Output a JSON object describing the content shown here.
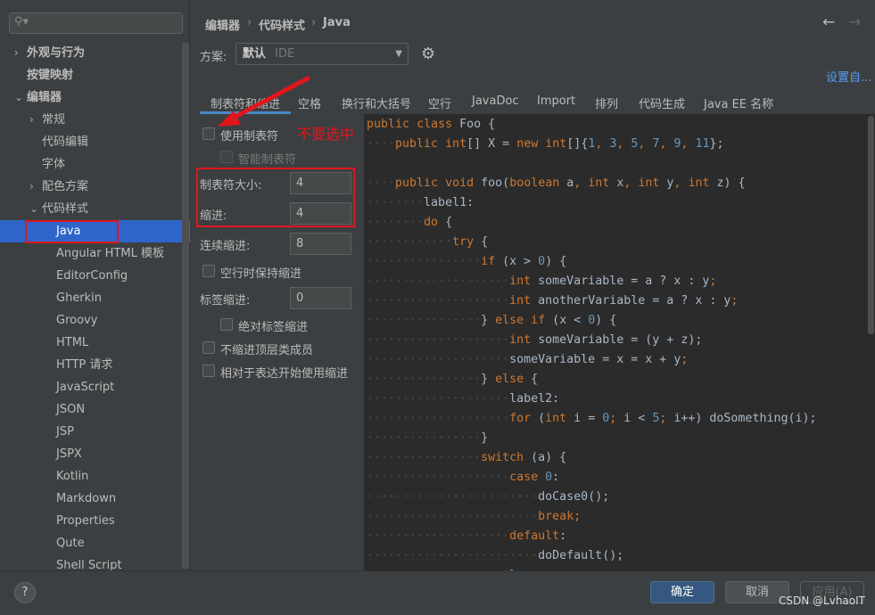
{
  "search": {
    "placeholder": ""
  },
  "sidebar": {
    "items": [
      {
        "label": "外观与行为",
        "arrow": "›",
        "level": 0
      },
      {
        "label": "按键映射",
        "arrow": "",
        "level": 0
      },
      {
        "label": "编辑器",
        "arrow": "⌄",
        "level": 0
      },
      {
        "label": "常规",
        "arrow": "›",
        "level": 1
      },
      {
        "label": "代码编辑",
        "arrow": "",
        "level": 1
      },
      {
        "label": "字体",
        "arrow": "",
        "level": 1
      },
      {
        "label": "配色方案",
        "arrow": "›",
        "level": 1
      },
      {
        "label": "代码样式",
        "arrow": "⌄",
        "level": 1
      },
      {
        "label": "Java",
        "arrow": "",
        "level": 2,
        "selected": true
      },
      {
        "label": "Angular HTML 模板",
        "arrow": "",
        "level": 2
      },
      {
        "label": "EditorConfig",
        "arrow": "",
        "level": 2
      },
      {
        "label": "Gherkin",
        "arrow": "",
        "level": 2
      },
      {
        "label": "Groovy",
        "arrow": "",
        "level": 2
      },
      {
        "label": "HTML",
        "arrow": "",
        "level": 2
      },
      {
        "label": "HTTP 请求",
        "arrow": "",
        "level": 2
      },
      {
        "label": "JavaScript",
        "arrow": "",
        "level": 2
      },
      {
        "label": "JSON",
        "arrow": "",
        "level": 2
      },
      {
        "label": "JSP",
        "arrow": "",
        "level": 2
      },
      {
        "label": "JSPX",
        "arrow": "",
        "level": 2
      },
      {
        "label": "Kotlin",
        "arrow": "",
        "level": 2
      },
      {
        "label": "Markdown",
        "arrow": "",
        "level": 2
      },
      {
        "label": "Properties",
        "arrow": "",
        "level": 2
      },
      {
        "label": "Qute",
        "arrow": "",
        "level": 2
      },
      {
        "label": "Shell Script",
        "arrow": "",
        "level": 2
      }
    ]
  },
  "breadcrumb": [
    "编辑器",
    "代码样式",
    "Java"
  ],
  "nav": {
    "back": "←",
    "forward": "→"
  },
  "scheme": {
    "label": "方案:",
    "value": "默认",
    "hint": "IDE",
    "set_from": "设置自..."
  },
  "tabs": [
    "制表符和缩进",
    "空格",
    "换行和大括号",
    "空行",
    "JavaDoc",
    "Import",
    "排列",
    "代码生成",
    "Java EE 名称"
  ],
  "options": {
    "use_tab": {
      "label": "使用制表符",
      "checked": false
    },
    "smart_tab": {
      "label": "智能制表符",
      "checked": false,
      "disabled": true
    },
    "tab_size": {
      "label": "制表符大小:",
      "value": "4"
    },
    "indent": {
      "label": "缩进:",
      "value": "4"
    },
    "continuation": {
      "label": "连续缩进:",
      "value": "8"
    },
    "keep_indent": {
      "label": "空行时保持缩进",
      "checked": false
    },
    "label_indent": {
      "label": "标签缩进:",
      "value": "0"
    },
    "abs_label": {
      "label": "绝对标签缩进",
      "checked": false
    },
    "no_indent_top": {
      "label": "不缩进顶层类成员",
      "checked": false
    },
    "relative_indent": {
      "label": "相对于表达开始使用缩进",
      "checked": false
    }
  },
  "annotation": {
    "text": "不要选中",
    "color": "#e0161d"
  },
  "code": {
    "keywords": [
      "public",
      "class",
      "int",
      "new",
      "void",
      "boolean",
      "do",
      "try",
      "if",
      "else",
      "for",
      "switch",
      "case",
      "break",
      "default"
    ],
    "lines": [
      {
        "indent": 0,
        "text": "public class Foo {"
      },
      {
        "indent": 4,
        "text": "public int[] X = new int[]{1, 3, 5, 7, 9, 11};"
      },
      {
        "indent": 0,
        "text": ""
      },
      {
        "indent": 4,
        "text": "public void foo(boolean a, int x, int y, int z) {"
      },
      {
        "indent": 8,
        "text": "label1:"
      },
      {
        "indent": 8,
        "text": "do {"
      },
      {
        "indent": 12,
        "text": "try {"
      },
      {
        "indent": 16,
        "text": "if (x > 0) {"
      },
      {
        "indent": 20,
        "text": "int someVariable = a ? x : y;"
      },
      {
        "indent": 20,
        "text": "int anotherVariable = a ? x : y;"
      },
      {
        "indent": 16,
        "text": "} else if (x < 0) {"
      },
      {
        "indent": 20,
        "text": "int someVariable = (y + z);"
      },
      {
        "indent": 20,
        "text": "someVariable = x = x + y;"
      },
      {
        "indent": 16,
        "text": "} else {"
      },
      {
        "indent": 20,
        "text": "label2:"
      },
      {
        "indent": 20,
        "text": "for (int i = 0; i < 5; i++) doSomething(i);"
      },
      {
        "indent": 16,
        "text": "}"
      },
      {
        "indent": 16,
        "text": "switch (a) {"
      },
      {
        "indent": 20,
        "text": "case 0:"
      },
      {
        "indent": 24,
        "text": "doCase0();"
      },
      {
        "indent": 24,
        "text": "break;"
      },
      {
        "indent": 20,
        "text": "default:"
      },
      {
        "indent": 24,
        "text": "doDefault();"
      },
      {
        "indent": 20,
        "text": "}"
      }
    ]
  },
  "footer": {
    "help": "?",
    "ok": "确定",
    "cancel": "取消",
    "apply": "应用(A)",
    "watermark": "CSDN @LvhaoIT"
  },
  "colors": {
    "accent": "#2f65ca",
    "keyword": "#cc7832",
    "number": "#6897bb",
    "identifier": "#a9b7c6",
    "editor_bg": "#2b2b2b"
  }
}
